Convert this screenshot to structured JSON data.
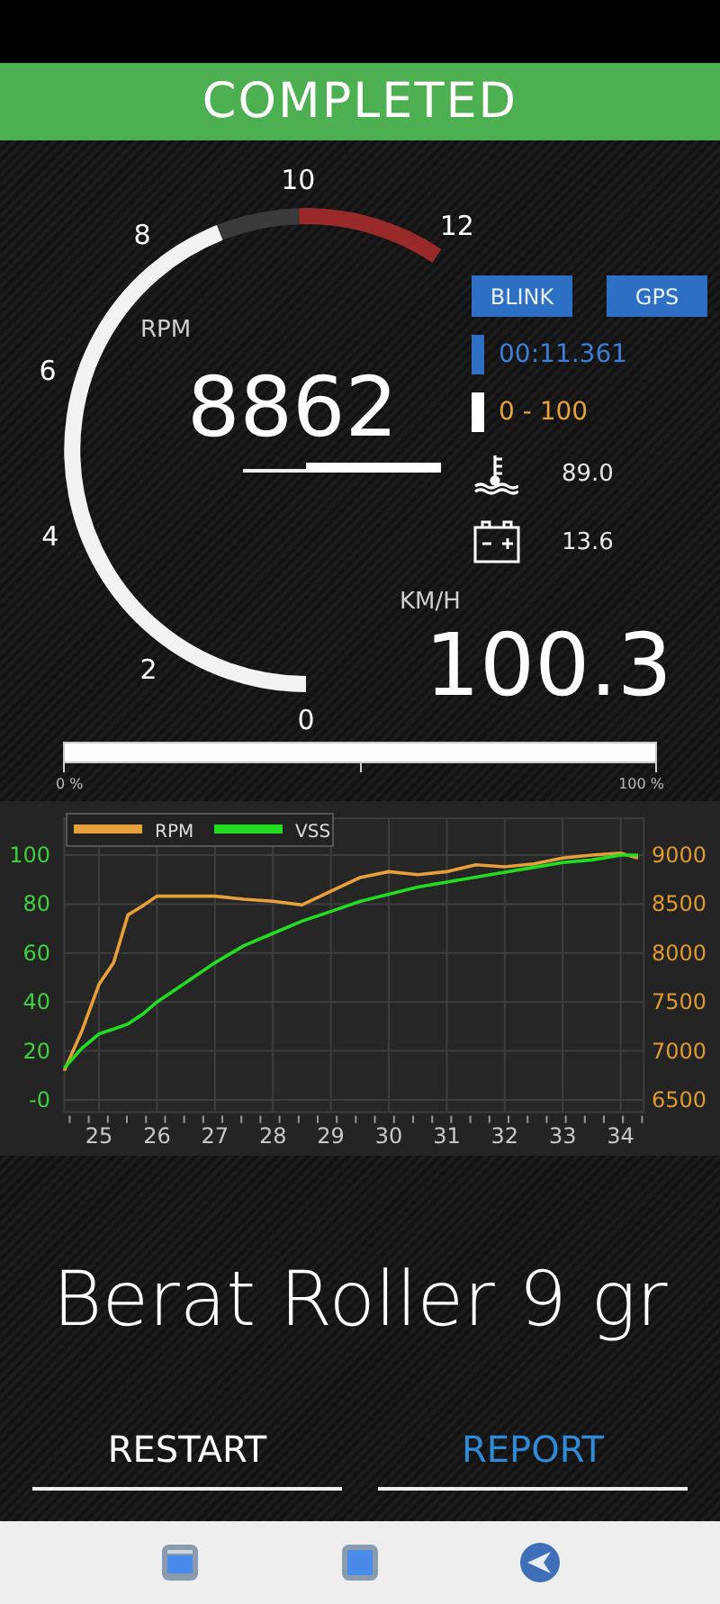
{
  "status_banner": "COMPLETED",
  "gauge": {
    "label": "RPM",
    "value": "8862",
    "ticks": [
      "0",
      "2",
      "4",
      "6",
      "8",
      "10",
      "12"
    ]
  },
  "buttons": [
    {
      "label": "BLINK"
    },
    {
      "label": "GPS"
    }
  ],
  "readouts": [
    {
      "kind": "timer",
      "text": "00:11.361",
      "color": "#2f6fc4"
    },
    {
      "kind": "range",
      "text": "0 - 100",
      "color": "#ffffff"
    },
    {
      "kind": "temperature",
      "text": "89.0"
    },
    {
      "kind": "battery",
      "text": "13.6"
    }
  ],
  "speed": {
    "unit": "KM/H",
    "value": "100.3"
  },
  "progress": {
    "level": 1,
    "start_label": "0 %",
    "end_label": "100 %"
  },
  "chart": {
    "chart_data": {
      "type": "line",
      "x": [
        24.4,
        24.7,
        25,
        25.25,
        25.5,
        25.75,
        26,
        26.5,
        27,
        27.5,
        28,
        28.5,
        29,
        29.5,
        30,
        30.5,
        31,
        31.5,
        32,
        32.5,
        33,
        33.5,
        34,
        34.3
      ],
      "series": [
        {
          "name": "RPM",
          "color": "#e8a03a",
          "axis": "y2",
          "values": [
            6800,
            7200,
            7680,
            7900,
            8390,
            8480,
            8580,
            8580,
            8580,
            8550,
            8530,
            8490,
            8630,
            8770,
            8830,
            8800,
            8830,
            8900,
            8880,
            8910,
            8970,
            9000,
            9020,
            8970
          ]
        },
        {
          "name": "VSS",
          "color": "#22dd22",
          "values": [
            13,
            21,
            27,
            29,
            31,
            35,
            40,
            48,
            56,
            63,
            68,
            73,
            77,
            81,
            84,
            87,
            89,
            91,
            93,
            95,
            97,
            98,
            100,
            100
          ]
        }
      ],
      "grid": true,
      "legend": "top-left",
      "xlim": [
        24.4,
        34.4
      ],
      "ylim": [
        -5,
        115
      ],
      "y2lim": [
        6375,
        9375
      ],
      "xticks": [
        25,
        26,
        27,
        28,
        29,
        30,
        31,
        32,
        33,
        34
      ],
      "yticks": [
        {
          "value": 0,
          "label": "-0"
        },
        20,
        40,
        60,
        80,
        100
      ],
      "y2ticks": [
        6500,
        7000,
        7500,
        8000,
        8500,
        9000
      ]
    }
  },
  "session_name": "Berat Roller 9 gr",
  "actions": [
    {
      "label": "RESTART",
      "kind": "secondary"
    },
    {
      "label": "REPORT",
      "kind": "primary"
    }
  ]
}
